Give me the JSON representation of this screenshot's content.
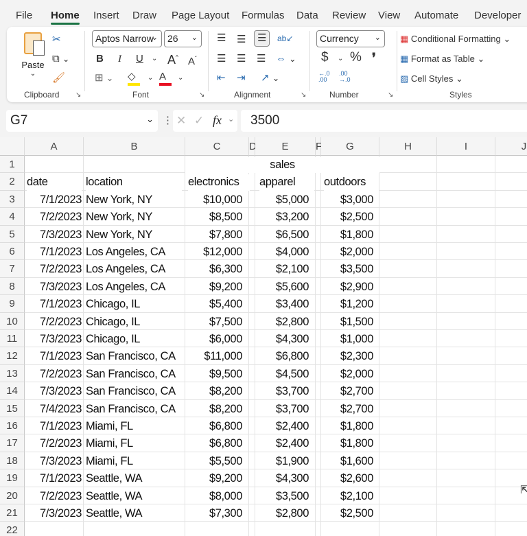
{
  "tabs": [
    "File",
    "Home",
    "Insert",
    "Draw",
    "Page Layout",
    "Formulas",
    "Data",
    "Review",
    "View",
    "Automate",
    "Developer"
  ],
  "active_tab": "Home",
  "ribbon": {
    "clipboard": {
      "paste": "Paste",
      "label": "Clipboard"
    },
    "font": {
      "name": "Aptos Narrow",
      "size": "26",
      "bold": "B",
      "italic": "I",
      "underline": "U",
      "label": "Font",
      "fill_color": "#ffe600",
      "font_color": "#e81123"
    },
    "alignment": {
      "label": "Alignment"
    },
    "number": {
      "format": "Currency",
      "currency": "$",
      "percent": "%",
      "comma": "❜",
      "inc_decimal": "←.0 .00",
      "dec_decimal": ".00 →.0",
      "label": "Number"
    },
    "styles": {
      "conditional": "Conditional Formatting",
      "table": "Format as Table",
      "cell": "Cell Styles",
      "label": "Styles"
    }
  },
  "formula_bar": {
    "name_box": "G7",
    "fx": "fx",
    "value": "3500"
  },
  "columns": [
    "A",
    "B",
    "C",
    "D",
    "E",
    "F",
    "G",
    "H",
    "I",
    "J"
  ],
  "sheet": {
    "title": "sales",
    "headers": [
      "date",
      "location",
      "electronics",
      "apparel",
      "outdoors"
    ],
    "rows": [
      [
        "7/1/2023",
        "New York, NY",
        "$10,000",
        "$5,000",
        "$3,000"
      ],
      [
        "7/2/2023",
        "New York, NY",
        "$8,500",
        "$3,200",
        "$2,500"
      ],
      [
        "7/3/2023",
        "New York, NY",
        "$7,800",
        "$6,500",
        "$1,800"
      ],
      [
        "7/1/2023",
        "Los Angeles, CA",
        "$12,000",
        "$4,000",
        "$2,000"
      ],
      [
        "7/2/2023",
        "Los Angeles, CA",
        "$6,300",
        "$2,100",
        "$3,500"
      ],
      [
        "7/3/2023",
        "Los Angeles, CA",
        "$9,200",
        "$5,600",
        "$2,900"
      ],
      [
        "7/1/2023",
        "Chicago, IL",
        "$5,400",
        "$3,400",
        "$1,200"
      ],
      [
        "7/2/2023",
        "Chicago, IL",
        "$7,500",
        "$2,800",
        "$1,500"
      ],
      [
        "7/3/2023",
        "Chicago, IL",
        "$6,000",
        "$4,300",
        "$1,000"
      ],
      [
        "7/1/2023",
        "San Francisco, CA",
        "$11,000",
        "$6,800",
        "$2,300"
      ],
      [
        "7/2/2023",
        "San Francisco, CA",
        "$9,500",
        "$4,500",
        "$2,000"
      ],
      [
        "7/3/2023",
        "San Francisco, CA",
        "$8,200",
        "$3,700",
        "$2,700"
      ],
      [
        "7/4/2023",
        "San Francisco, CA",
        "$8,200",
        "$3,700",
        "$2,700"
      ],
      [
        "7/1/2023",
        "Miami, FL",
        "$6,800",
        "$2,400",
        "$1,800"
      ],
      [
        "7/2/2023",
        "Miami, FL",
        "$6,800",
        "$2,400",
        "$1,800"
      ],
      [
        "7/3/2023",
        "Miami, FL",
        "$5,500",
        "$1,900",
        "$1,600"
      ],
      [
        "7/1/2023",
        "Seattle, WA",
        "$9,200",
        "$4,300",
        "$2,600"
      ],
      [
        "7/2/2023",
        "Seattle, WA",
        "$8,000",
        "$3,500",
        "$2,100"
      ],
      [
        "7/3/2023",
        "Seattle, WA",
        "$7,300",
        "$2,800",
        "$2,500"
      ]
    ],
    "row_numbers": [
      "1",
      "2",
      "3",
      "4",
      "5",
      "6",
      "7",
      "8",
      "9",
      "10",
      "11",
      "12",
      "13",
      "14",
      "15",
      "16",
      "17",
      "18",
      "19",
      "20",
      "21",
      "22"
    ]
  }
}
